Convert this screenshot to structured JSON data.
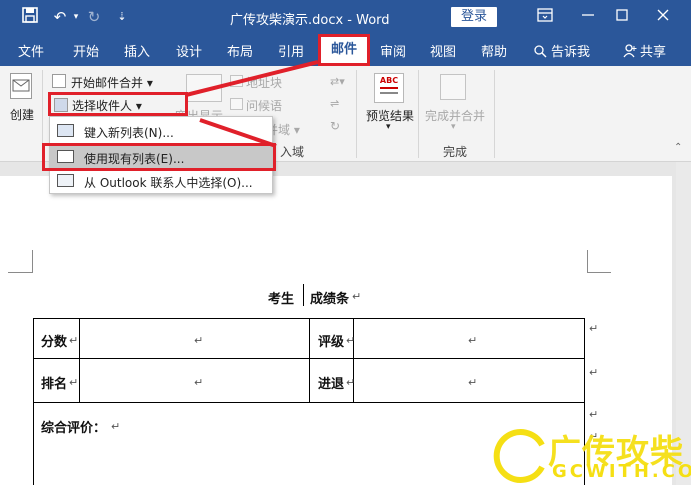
{
  "titlebar": {
    "title": "广传攻柴演示.docx  -  Word",
    "login_label": "登录",
    "undo_glyph": "↶",
    "redo_glyph": "↻",
    "qat_more_glyph": "⇣"
  },
  "tabs": [
    "文件",
    "开始",
    "插入",
    "设计",
    "布局",
    "引用",
    "邮件",
    "审阅",
    "视图",
    "帮助"
  ],
  "tell_me": "告诉我",
  "share": "共享",
  "ribbon": {
    "create_label": "创建",
    "start_merge": "开始邮件合并",
    "select_recipients": "选择收件人",
    "highlight_fields": "突出显示",
    "address_block": "地址块",
    "greeting_line": "问候语",
    "insert_merge_field": "插入合并域",
    "preview_results": "预览结果",
    "finish_merge": "完成并合并",
    "group_write_insert": "入域",
    "group_finish": "完成",
    "abc_label": "ABC"
  },
  "dropdown": {
    "items": [
      "键入新列表(N)...",
      "使用现有列表(E)...",
      "从 Outlook 联系人中选择(O)..."
    ]
  },
  "document": {
    "heading_left": "考生",
    "heading_right": "成绩条",
    "para_mark": "↵",
    "row1": {
      "label_a": "分数",
      "label_b": "评级"
    },
    "row2": {
      "label_a": "排名",
      "label_b": "进退"
    },
    "comment_label": "综合评价："
  },
  "watermark": {
    "text": "广传攻柴",
    "sub": "GCWITH.COM"
  },
  "colors": {
    "word_blue": "#2b579a",
    "annotation_red": "#e0202a",
    "watermark_yellow": "#f5df14",
    "menu_highlight": "#c8c8c8"
  }
}
